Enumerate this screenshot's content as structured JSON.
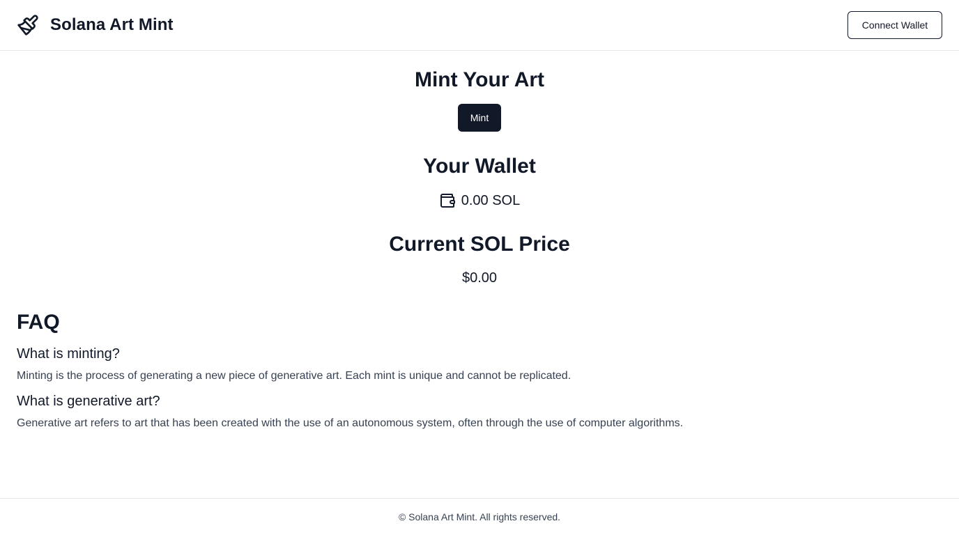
{
  "header": {
    "brand_icon": "paintbrush-icon",
    "title": "Solana Art Mint",
    "connect_label": "Connect Wallet"
  },
  "mint": {
    "heading": "Mint Your Art",
    "button_label": "Mint"
  },
  "wallet": {
    "heading": "Your Wallet",
    "icon": "wallet-icon",
    "balance": "0.00 SOL"
  },
  "price": {
    "heading": "Current SOL Price",
    "value": "$0.00"
  },
  "faq": {
    "title": "FAQ",
    "items": [
      {
        "question": "What is minting?",
        "answer": "Minting is the process of generating a new piece of generative art. Each mint is unique and cannot be replicated."
      },
      {
        "question": "What is generative art?",
        "answer": "Generative art refers to art that has been created with the use of an autonomous system, often through the use of computer algorithms."
      }
    ]
  },
  "footer": {
    "text": "© Solana Art Mint. All rights reserved."
  },
  "colors": {
    "primary": "#111827",
    "border": "#e5e7eb",
    "muted_text": "#374151",
    "background": "#ffffff"
  }
}
